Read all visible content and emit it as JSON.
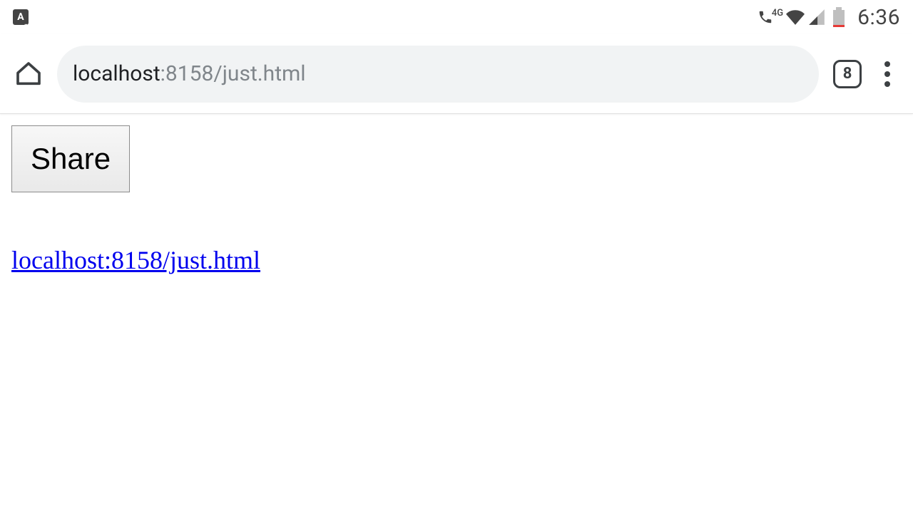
{
  "status_bar": {
    "keyboard_indicator": "A",
    "network_label": "4G",
    "clock": "6:36"
  },
  "browser": {
    "url_host": "localhost",
    "url_path": ":8158/just.html",
    "tab_count": "8"
  },
  "page": {
    "share_button_label": "Share",
    "link_text": "localhost:8158/just.html"
  }
}
